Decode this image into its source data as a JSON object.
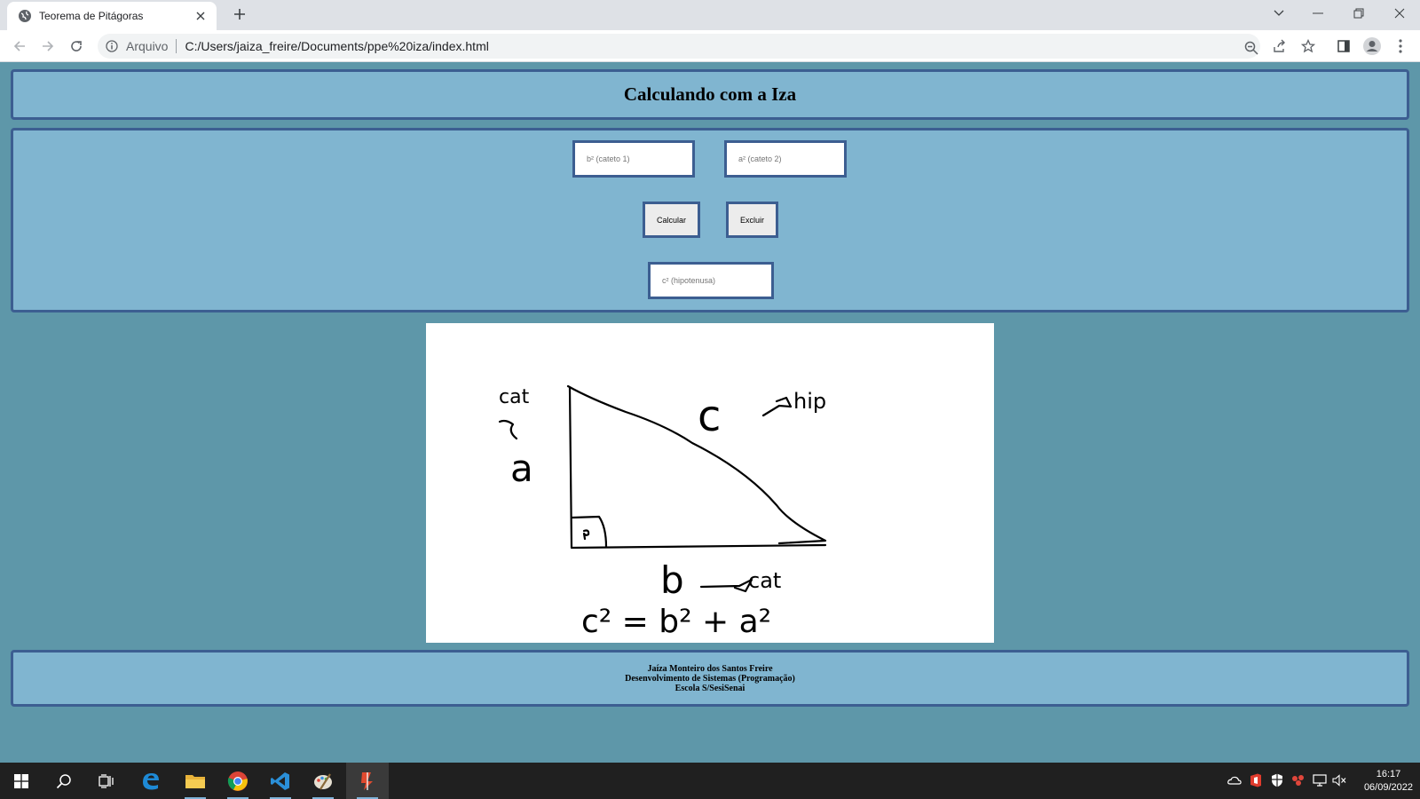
{
  "browser": {
    "tab_title": "Teorema de Pitágoras",
    "address_label": "Arquivo",
    "url": "C:/Users/jaiza_freire/Documents/ppe%20iza/index.html"
  },
  "page": {
    "title": "Calculando com a Iza",
    "form": {
      "cateto1_placeholder": "b² (cateto 1)",
      "cateto2_placeholder": "a² (cateto 2)",
      "calcular_label": "Calcular",
      "excluir_label": "Excluir",
      "hipotenusa_placeholder": "c² (hipotenusa)"
    },
    "drawing": {
      "label_top_left": "cat",
      "label_a": "a",
      "label_c": "c",
      "label_hip": "hip",
      "label_b": "b",
      "label_bottom_cat": "cat",
      "formula": "c² = b² + a²"
    },
    "footer": {
      "line1": "Jaíza Monteiro dos Santos Freire",
      "line2": "Desenvolvimento de Sistemas (Programação)",
      "line3": "Escola S/SesiSenai"
    }
  },
  "taskbar": {
    "apps": [
      "windows-start",
      "search",
      "task-view",
      "edge",
      "file-explorer",
      "chrome",
      "vscode",
      "paint",
      "active-app"
    ],
    "time": "16:17",
    "date": "06/09/2022"
  },
  "colors": {
    "page_bg": "#5e97a9",
    "panel_bg": "#80b5d0",
    "panel_border": "#3c5e91"
  }
}
